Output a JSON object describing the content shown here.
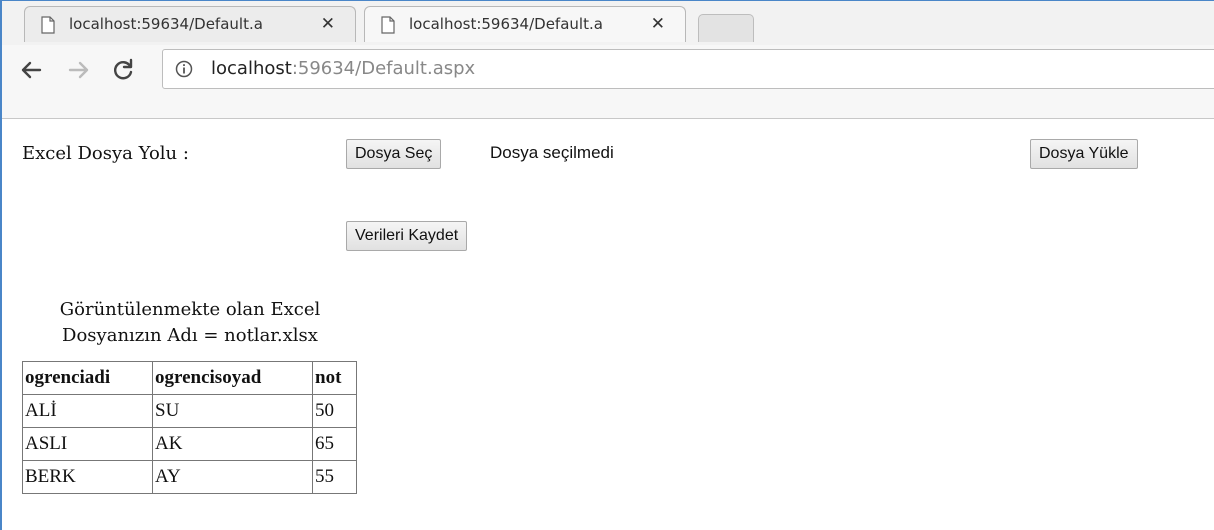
{
  "browser": {
    "tabs": [
      {
        "title": "localhost:59634/Default.a",
        "close": "✕",
        "active": false
      },
      {
        "title": "localhost:59634/Default.a",
        "close": "✕",
        "active": true
      }
    ],
    "address": {
      "host": "localhost",
      "rest": ":59634/Default.aspx"
    }
  },
  "form": {
    "path_label": "Excel Dosya Yolu :",
    "choose_button": "Dosya Seç",
    "no_file_text": "Dosya seçilmedi",
    "upload_button": "Dosya Yükle",
    "save_button": "Verileri Kaydet"
  },
  "grid": {
    "caption_line1": "Görüntülenmekte olan Excel",
    "caption_line2": "Dosyanızın Adı = notlar.xlsx",
    "headers": [
      "ogrenciadi",
      "ogrencisoyad",
      "not"
    ],
    "rows": [
      [
        "ALİ",
        "SU",
        "50"
      ],
      [
        "ASLI",
        "AK",
        "65"
      ],
      [
        "BERK",
        "AY",
        "55"
      ]
    ]
  },
  "colors": {
    "frame_accent": "#4a86c8"
  }
}
